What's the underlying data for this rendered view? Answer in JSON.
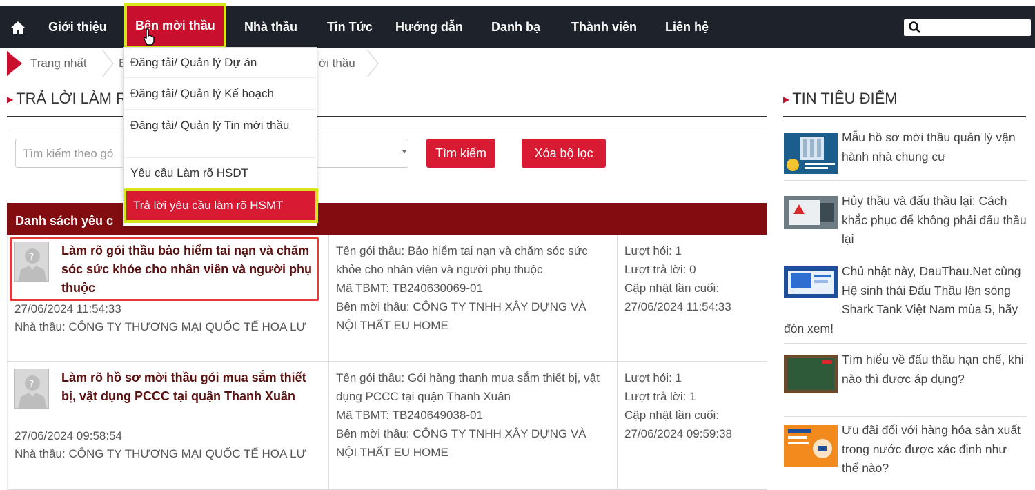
{
  "nav": {
    "items": [
      {
        "label": "Giới thiệu"
      },
      {
        "label": "Bên mời thầu"
      },
      {
        "label": "Nhà thầu"
      },
      {
        "label": "Tin Tức"
      },
      {
        "label": "Hướng dẫn"
      },
      {
        "label": "Danh bạ"
      },
      {
        "label": "Thành viên"
      },
      {
        "label": "Liên hệ"
      }
    ],
    "active_index": 1,
    "home_icon": "home-icon",
    "search_icon": "search-icon"
  },
  "breadcrumb": {
    "items": [
      "Trang nhất",
      "B",
      "ời thầu"
    ]
  },
  "dropdown": {
    "items": [
      "Đăng tải/ Quản lý Dự án",
      "Đăng tải/ Quản lý Kế hoạch",
      "Đăng tải/ Quản lý Tin mời thầu",
      "Yêu cầu Làm rõ HSDT",
      "Trả lời yêu cầu làm rõ HSMT"
    ],
    "active_index": 4
  },
  "page": {
    "title_visible": "TRẢ LỜI LÀM R",
    "accent_color": "#c8102e",
    "highlight_color": "#d6e61a"
  },
  "filter": {
    "placeholder": "Tìm kiếm theo gó",
    "search_label": "Tìm kiếm",
    "clear_label": "Xóa bộ lọc"
  },
  "table": {
    "header": "Danh sách yêu c",
    "rows": [
      {
        "title": "Làm rõ gói thầu bảo hiểm tai nạn và chăm sóc sức khỏe cho nhân viên và người phụ thuộc",
        "date": "27/06/2024 11:54:33",
        "contractor": "Nhà thầu: CÔNG TY THƯƠNG MẠI QUỐC TẾ HOA LƯ",
        "package": "Tên gói thầu: Bảo hiểm tai nạn và chăm sóc sức khỏe cho nhân viên và người phụ thuộc",
        "code": "Mã TBMT: TB240630069-01",
        "owner": "Bên mời thầu: CÔNG TY TNHH XÂY DỰNG VÀ NỘI THẤT EU HOME",
        "questions": "Lượt hỏi: 1",
        "answers": "Lượt trả lời: 0",
        "updated_label": "Cập nhật lần cuối:",
        "updated": "27/06/2024 11:54:33"
      },
      {
        "title": "Làm rõ hồ sơ mời thầu gói mua sắm thiết bị, vật dụng PCCC tại quận Thanh Xuân",
        "date": "27/06/2024 09:58:54",
        "contractor": "Nhà thầu: CÔNG TY THƯƠNG MẠI QUỐC TẾ HOA LƯ",
        "package": "Tên gói thầu: Gói hàng thanh mua sắm thiết bị, vật dụng PCCC tại quận Thanh Xuân",
        "code": "Mã TBMT: TB240649038-01",
        "owner": "Bên mời thầu: CÔNG TY TNHH XÂY DỰNG VÀ NỘI THẤT EU HOME",
        "questions": "Lượt hỏi: 1",
        "answers": "Lượt trả lời: 1",
        "updated_label": "Cập nhật lần cuối:",
        "updated": "27/06/2024 09:59:38"
      }
    ]
  },
  "sidebar": {
    "title": "TIN TIÊU ĐIỂM",
    "news": [
      {
        "text": "Mẫu hồ sơ mời thầu quản lý vận hành nhà chung cư"
      },
      {
        "text": "Hủy thầu và đấu thầu lại: Cách khắc phục để không phải đấu thầu lại"
      },
      {
        "text": "Chủ nhật này, DauThau.Net cùng Hệ sinh thái Đấu Thầu lên sóng Shark Tank Việt Nam mùa 5, hãy đón xem!"
      },
      {
        "text": "Tìm hiểu về đấu thầu hạn chế, khi nào thì được áp dụng?"
      },
      {
        "text": "Ưu đãi đối với hàng hóa sản xuất trong nước được xác định như thế nào?"
      }
    ]
  }
}
